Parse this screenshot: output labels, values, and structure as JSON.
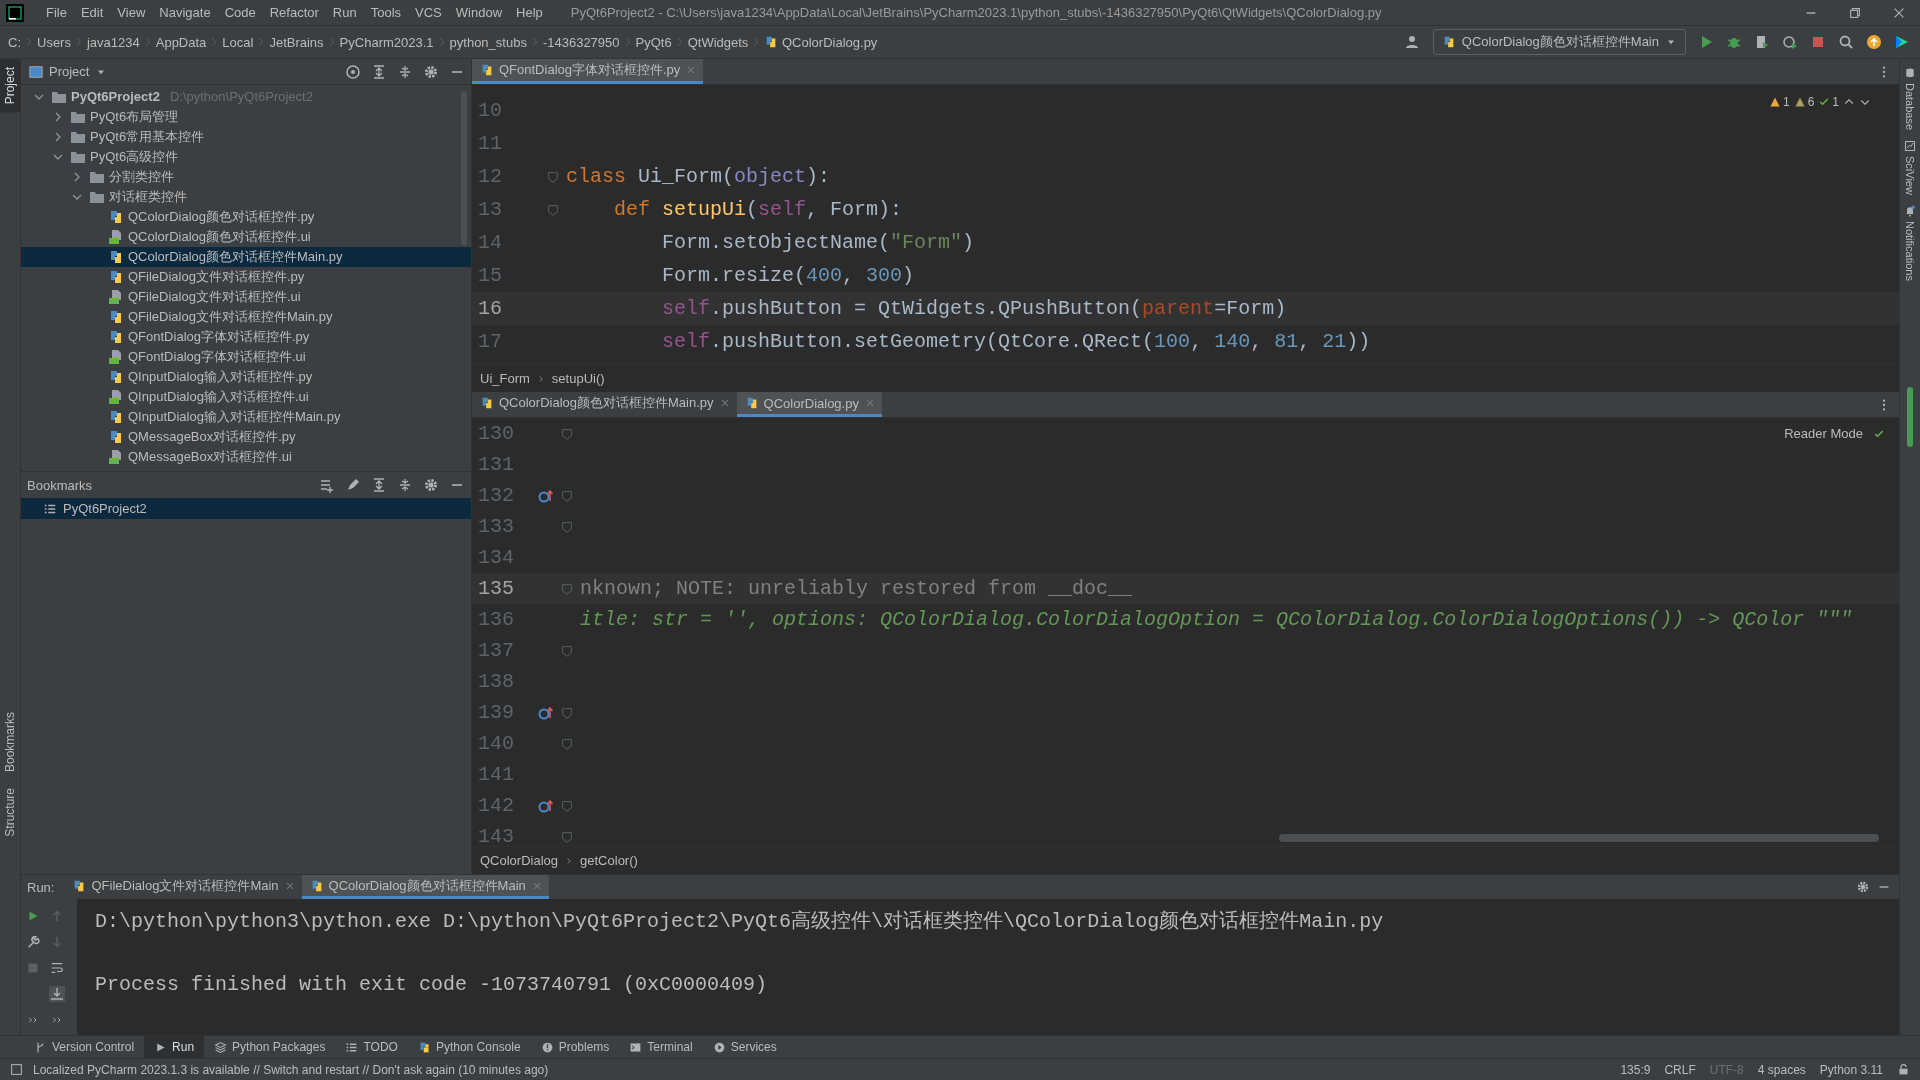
{
  "title_bar": {
    "menu": [
      "File",
      "Edit",
      "View",
      "Navigate",
      "Code",
      "Refactor",
      "Run",
      "Tools",
      "VCS",
      "Window",
      "Help"
    ],
    "title": "PyQt6Project2 - C:\\Users\\java1234\\AppData\\Local\\JetBrains\\PyCharm2023.1\\python_stubs\\-1436327950\\PyQt6\\QtWidgets\\QColorDialog.py"
  },
  "nav_bar": {
    "breadcrumbs": [
      "C:",
      "Users",
      "java1234",
      "AppData",
      "Local",
      "JetBrains",
      "PyCharm2023.1",
      "python_stubs",
      "-1436327950",
      "PyQt6",
      "QtWidgets",
      "QColorDialog.py"
    ],
    "run_config": "QColorDialog颜色对话框控件Main"
  },
  "left_strip": {
    "top": [
      {
        "label": "Project",
        "selected": true
      }
    ],
    "bottom": [
      {
        "label": "Bookmarks",
        "selected": false
      },
      {
        "label": "Structure",
        "selected": false
      }
    ]
  },
  "project_panel": {
    "title": "Project",
    "tree": [
      {
        "label": "PyQt6Project2",
        "path": "D:\\python\\PyQt6Project2",
        "kind": "project",
        "expanded": true,
        "selected": false,
        "children": [
          {
            "label": "PyQt6布局管理",
            "kind": "folder",
            "expanded": false,
            "selected": false
          },
          {
            "label": "PyQt6常用基本控件",
            "kind": "folder",
            "expanded": false,
            "selected": false
          },
          {
            "label": "PyQt6高级控件",
            "kind": "folder",
            "expanded": true,
            "selected": false,
            "children": [
              {
                "label": "分割类控件",
                "kind": "folder",
                "expanded": false,
                "selected": false
              },
              {
                "label": "对话框类控件",
                "kind": "folder",
                "expanded": true,
                "selected": false,
                "children": [
                  {
                    "label": "QColorDialog颜色对话框控件.py",
                    "kind": "python",
                    "selected": false
                  },
                  {
                    "label": "QColorDialog颜色对话框控件.ui",
                    "kind": "qt-ui",
                    "selected": false
                  },
                  {
                    "label": "QColorDialog颜色对话框控件Main.py",
                    "kind": "python",
                    "selected": true
                  },
                  {
                    "label": "QFileDialog文件对话框控件.py",
                    "kind": "python",
                    "selected": false
                  },
                  {
                    "label": "QFileDialog文件对话框控件.ui",
                    "kind": "qt-ui",
                    "selected": false
                  },
                  {
                    "label": "QFileDialog文件对话框控件Main.py",
                    "kind": "python",
                    "selected": false
                  },
                  {
                    "label": "QFontDialog字体对话框控件.py",
                    "kind": "python",
                    "selected": false
                  },
                  {
                    "label": "QFontDialog字体对话框控件.ui",
                    "kind": "qt-ui",
                    "selected": false
                  },
                  {
                    "label": "QInputDialog输入对话框控件.py",
                    "kind": "python",
                    "selected": false
                  },
                  {
                    "label": "QInputDialog输入对话框控件.ui",
                    "kind": "qt-ui",
                    "selected": false
                  },
                  {
                    "label": "QInputDialog输入对话框控件Main.py",
                    "kind": "python",
                    "selected": false
                  },
                  {
                    "label": "QMessageBox对话框控件.py",
                    "kind": "python",
                    "selected": false
                  },
                  {
                    "label": "QMessageBox对话框控件.ui",
                    "kind": "qt-ui",
                    "selected": false
                  }
                ]
              }
            ]
          }
        ]
      }
    ]
  },
  "bookmarks": {
    "title": "Bookmarks",
    "items": [
      {
        "label": "PyQt6Project2",
        "selected": true
      }
    ]
  },
  "editor_top": {
    "tabs": [
      {
        "label": "QFontDialog字体对话框控件.py",
        "selected": true
      }
    ],
    "inspections": [
      {
        "kind": "warning",
        "count": "1"
      },
      {
        "kind": "weak-warning",
        "count": "6"
      },
      {
        "kind": "ok",
        "count": "1"
      }
    ],
    "lines": [
      {
        "number": "10",
        "current": false,
        "fold": false
      },
      {
        "number": "11",
        "current": false,
        "fold": false
      },
      {
        "number": "12",
        "current": false,
        "fold": true,
        "tokens": [
          {
            "kind": "keyword",
            "text": "class"
          },
          {
            "kind": "plain",
            "text": " Ui_Form("
          },
          {
            "kind": "builtin",
            "text": "object"
          },
          {
            "kind": "plain",
            "text": "):"
          }
        ]
      },
      {
        "number": "13",
        "current": false,
        "fold": true,
        "tokens": [
          {
            "kind": "keyword",
            "text": "    def"
          },
          {
            "kind": "function",
            "text": " setupUi"
          },
          {
            "kind": "plain",
            "text": "("
          },
          {
            "kind": "self",
            "text": "self"
          },
          {
            "kind": "plain",
            "text": ", Form):"
          }
        ]
      },
      {
        "number": "14",
        "current": false,
        "fold": false,
        "tokens": [
          {
            "kind": "plain",
            "text": "        Form.setObjectName("
          },
          {
            "kind": "string",
            "text": "\"Form\""
          },
          {
            "kind": "plain",
            "text": ")"
          }
        ]
      },
      {
        "number": "15",
        "current": false,
        "fold": false,
        "tokens": [
          {
            "kind": "plain",
            "text": "        Form.resize("
          },
          {
            "kind": "number",
            "text": "400"
          },
          {
            "kind": "plain",
            "text": ", "
          },
          {
            "kind": "number",
            "text": "300"
          },
          {
            "kind": "plain",
            "text": ")"
          }
        ]
      },
      {
        "number": "16",
        "current": true,
        "fold": false,
        "tokens": [
          {
            "kind": "self",
            "text": "        self"
          },
          {
            "kind": "plain",
            "text": ".pushButton = QtWidgets.QPushButton("
          },
          {
            "kind": "param",
            "text": "parent"
          },
          {
            "kind": "plain",
            "text": "=Form)"
          }
        ]
      },
      {
        "number": "17",
        "current": false,
        "fold": false,
        "tokens": [
          {
            "kind": "self",
            "text": "        self"
          },
          {
            "kind": "plain",
            "text": ".pushButton.setGeometry(QtCore.QRect("
          },
          {
            "kind": "number",
            "text": "100"
          },
          {
            "kind": "plain",
            "text": ", "
          },
          {
            "kind": "number",
            "text": "140"
          },
          {
            "kind": "plain",
            "text": ", "
          },
          {
            "kind": "number",
            "text": "81"
          },
          {
            "kind": "plain",
            "text": ", "
          },
          {
            "kind": "number",
            "text": "21"
          },
          {
            "kind": "plain",
            "text": "))"
          }
        ]
      }
    ],
    "breadcrumbs": [
      "Ui_Form",
      "setupUi()"
    ]
  },
  "editor_bottom": {
    "tabs": [
      {
        "label": "QColorDialog颜色对话框控件Main.py",
        "selected": false
      },
      {
        "label": "QColorDialog.py",
        "selected": true
      }
    ],
    "reader_mode": "Reader Mode",
    "lines": [
      {
        "number": "130",
        "current": false,
        "override": false,
        "fold": true
      },
      {
        "number": "131",
        "current": false,
        "override": false,
        "fold": false
      },
      {
        "number": "132",
        "current": false,
        "override": true,
        "fold": true
      },
      {
        "number": "133",
        "current": false,
        "override": false,
        "fold": true
      },
      {
        "number": "134",
        "current": false,
        "override": false,
        "fold": false
      },
      {
        "number": "135",
        "current": true,
        "override": false,
        "fold": true,
        "tokens": [
          {
            "kind": "comment",
            "text": "nknown; NOTE: unreliably restored from __doc__"
          }
        ]
      },
      {
        "number": "136",
        "current": false,
        "override": false,
        "fold": false,
        "tokens": [
          {
            "kind": "docstring",
            "text": "itle: str = '', options: QColorDialog.ColorDialogOption = QColorDialog.ColorDialogOptions()) -> QColor \"\"\""
          }
        ]
      },
      {
        "number": "137",
        "current": false,
        "override": false,
        "fold": true
      },
      {
        "number": "138",
        "current": false,
        "override": false,
        "fold": false
      },
      {
        "number": "139",
        "current": false,
        "override": true,
        "fold": true
      },
      {
        "number": "140",
        "current": false,
        "override": false,
        "fold": true
      },
      {
        "number": "141",
        "current": false,
        "override": false,
        "fold": false
      },
      {
        "number": "142",
        "current": false,
        "override": true,
        "fold": true
      },
      {
        "number": "143",
        "current": false,
        "override": false,
        "fold": true
      }
    ],
    "breadcrumbs": [
      "QColorDialog",
      "getColor()"
    ]
  },
  "right_strip": [
    {
      "label": "Database",
      "kind": "database"
    },
    {
      "label": "SciView",
      "kind": "sciview"
    },
    {
      "label": "Notifications",
      "kind": "bell"
    }
  ],
  "run_panel": {
    "label": "Run:",
    "tabs": [
      {
        "label": "QFileDialog文件对话框控件Main",
        "selected": false
      },
      {
        "label": "QColorDialog颜色对话框控件Main",
        "selected": true
      }
    ],
    "output": [
      "D:\\python\\python3\\python.exe D:\\python\\PyQt6Project2\\PyQt6高级控件\\对话框类控件\\QColorDialog颜色对话框控件Main.py",
      "Process finished with exit code -1073740791 (0xC0000409)"
    ]
  },
  "tool_bar": [
    {
      "label": "Version Control",
      "kind": "vcs",
      "selected": false
    },
    {
      "label": "Run",
      "kind": "run",
      "selected": true
    },
    {
      "label": "Python Packages",
      "kind": "packages",
      "selected": false
    },
    {
      "label": "TODO",
      "kind": "todo",
      "selected": false
    },
    {
      "label": "Python Console",
      "kind": "console",
      "selected": false
    },
    {
      "label": "Problems",
      "kind": "problems",
      "selected": false
    },
    {
      "label": "Terminal",
      "kind": "terminal",
      "selected": false
    },
    {
      "label": "Services",
      "kind": "services",
      "selected": false
    }
  ],
  "status_bar": {
    "message": "Localized PyCharm 2023.1.3 is available // Switch and restart // Don't ask again (10 minutes ago)",
    "items": [
      {
        "text": "135:9",
        "disabled": false
      },
      {
        "text": "CRLF",
        "disabled": false
      },
      {
        "text": "UTF-8",
        "disabled": true
      },
      {
        "text": "4 spaces",
        "disabled": false
      },
      {
        "text": "Python 3.11",
        "disabled": false
      }
    ]
  }
}
